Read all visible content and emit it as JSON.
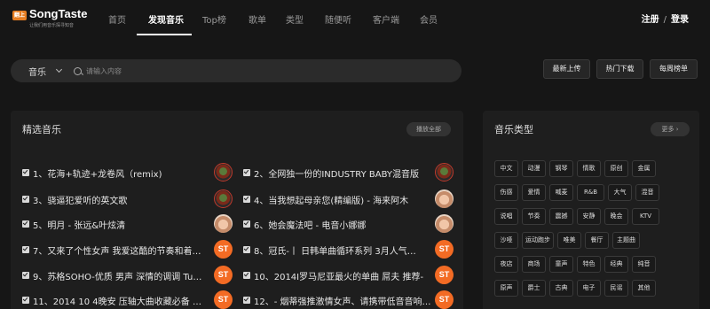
{
  "brand": {
    "badge": "翻上",
    "name": "SongTaste",
    "slogan": "让我们用音乐探寻知音"
  },
  "nav": [
    "首页",
    "发现音乐",
    "Top榜",
    "歌单",
    "类型",
    "随便听",
    "客户端",
    "会员"
  ],
  "auth": {
    "register": "注册",
    "separator": "/",
    "login": "登录"
  },
  "search": {
    "category": "音乐",
    "placeholder": "请输入内容"
  },
  "quick_buttons": [
    "最新上传",
    "热门下载",
    "每周榜单"
  ],
  "featured": {
    "title": "精选音乐",
    "play_all": "播放全部",
    "songs": [
      {
        "title": "1、花海+轨迹+龙卷风（remix)",
        "avatar": "dark"
      },
      {
        "title": "2、全网独一份的INDUSTRY BABY混音版",
        "avatar": "dark"
      },
      {
        "title": "3、骁逼犯爱听的英文歌",
        "avatar": "dark"
      },
      {
        "title": "4、当我想起母亲您(精编版) - 海来阿木",
        "avatar": "kid"
      },
      {
        "title": "5、明月 - 张远&叶炫清",
        "avatar": "kid"
      },
      {
        "title": "6、她会魔法吧 - 电音小娜娜",
        "avatar": "kid"
      },
      {
        "title": "7、又来了个性女声 我爱这酷的节奏和着…",
        "avatar": "st"
      },
      {
        "title": "8、冠氏-丨 日韩单曲循环系列 3月人气…",
        "avatar": "st"
      },
      {
        "title": "9、苏格SOHO-优质 男声 深情的调调 Tu…",
        "avatar": "st"
      },
      {
        "title": "10、2014I罗马尼亚最火的单曲 屌夫 推荐-",
        "avatar": "st"
      },
      {
        "title": "11、2014 10 4晚安 压轴大曲收藏必备 …",
        "avatar": "st"
      },
      {
        "title": "12、- 烟蒂强推激情女声、请携带低音音响…",
        "avatar": "st"
      }
    ],
    "avatar_st_text": "ST"
  },
  "genres": {
    "title": "音乐类型",
    "more": "更多",
    "more_chevron": "›",
    "tags": [
      "中文",
      "动漫",
      "钢琴",
      "情歌",
      "原创",
      "金属",
      "伤感",
      "爱情",
      "喊麦",
      "R&B",
      "大气",
      "混音",
      "说唱",
      "节奏",
      "震撼",
      "安静",
      "晚会",
      "KTV",
      "沙哑",
      "运动跑步",
      "唯美",
      "餐厅",
      "主题曲",
      "夜店",
      "商场",
      "童声",
      "特色",
      "经典",
      "纯音",
      "原声",
      "爵士",
      "古典",
      "电子",
      "民谣",
      "其他"
    ]
  },
  "colors": {
    "background": "#161616",
    "panel": "#1e1e1e",
    "accent": "#f36b24",
    "brand": "#e67e22"
  }
}
